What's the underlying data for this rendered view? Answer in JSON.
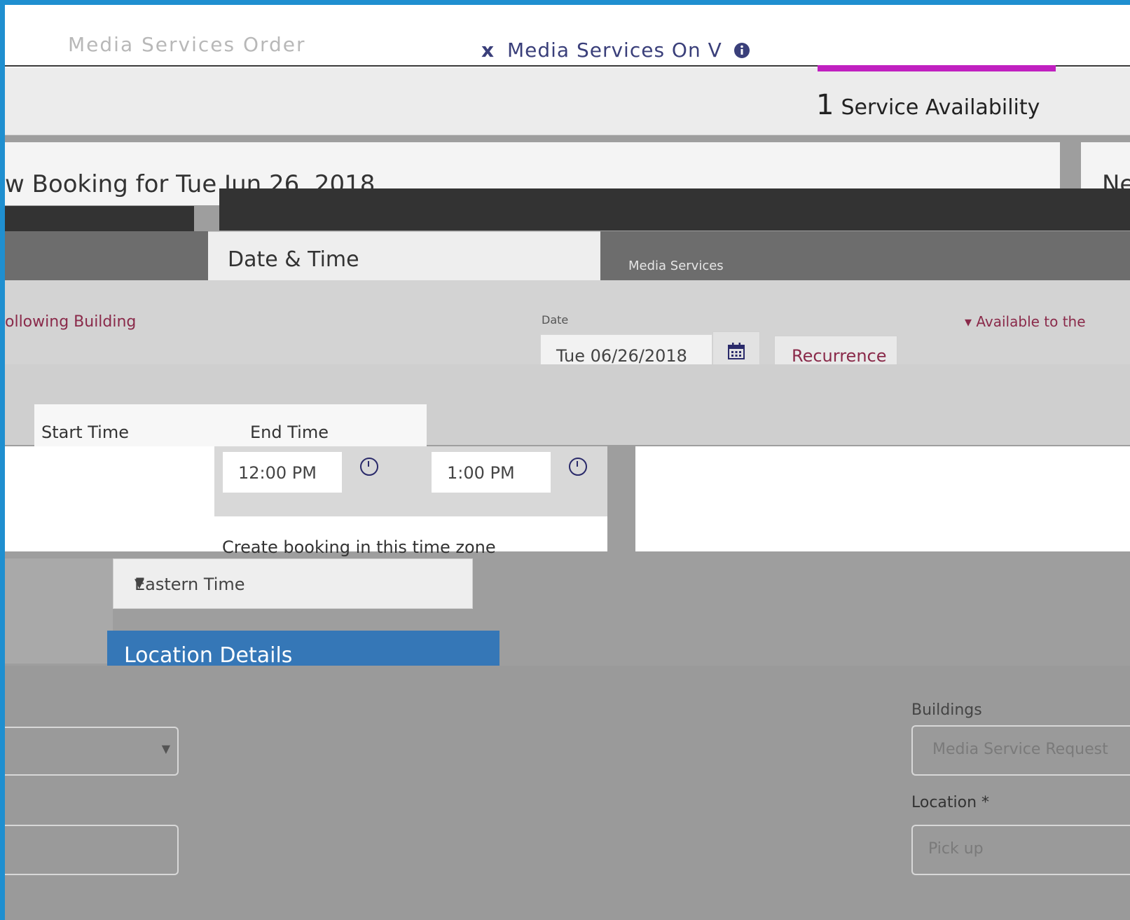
{
  "header": {
    "faint_title": "Media Services Order",
    "tab_title": "Media Services On V",
    "tab_close_glyph": "x",
    "info_icon": "info-circle-icon"
  },
  "steps": {
    "current_number": "1",
    "current_label": "Service Availability"
  },
  "booking": {
    "title": "w Booking for Tue Jun 26, 2018",
    "next_panel_label": "Ne"
  },
  "date_time": {
    "tab_label": "Date & Time",
    "panel_label": "Media Services",
    "building_link": "ollowing Building",
    "date_label": "Date",
    "date_value": "Tue 06/26/2018",
    "calendar_icon": "calendar-icon",
    "recurrence_label": "Recurrence",
    "available_label": "▾ Available to the",
    "start_time_label": "Start Time",
    "end_time_label": "End Time",
    "start_time_value": "12:00 PM",
    "end_time_value": "1:00 PM",
    "clock_icon": "clock-icon",
    "timezone_label": "Create booking in this time zone",
    "timezone_value": "Eastern Time"
  },
  "location": {
    "section_button": "Location Details",
    "buildings_label": "Buildings",
    "buildings_value": "Media Service Request",
    "location_label": "Location *",
    "location_placeholder": "Pick up"
  },
  "colors": {
    "step_underline": "#c020c0",
    "primary_button": "#3577b7",
    "link": "#8a2a4a"
  }
}
